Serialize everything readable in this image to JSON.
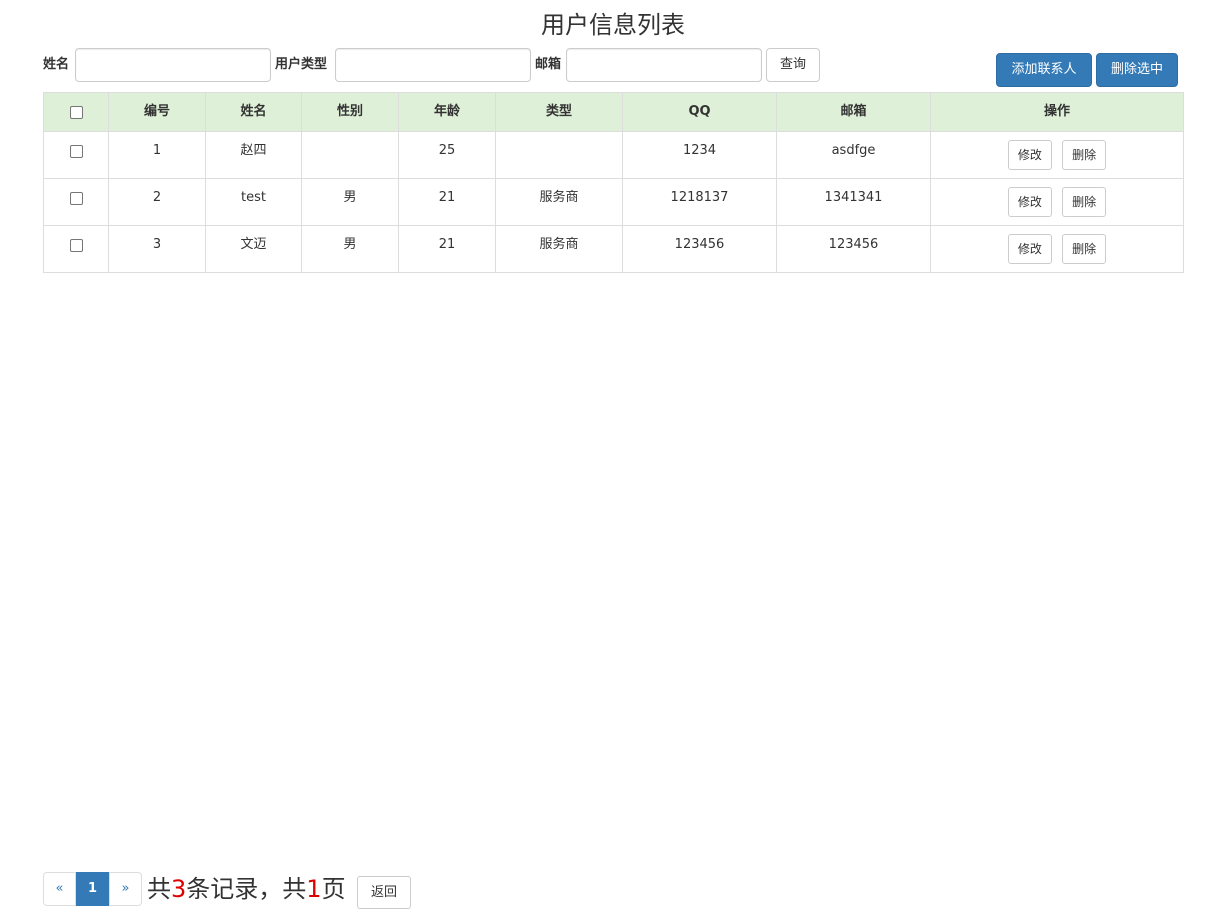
{
  "title": "用户信息列表",
  "search": {
    "name_label": "姓名",
    "name_value": "",
    "type_label": "用户类型",
    "type_value": "",
    "email_label": "邮箱",
    "email_value": "",
    "query_label": "查询"
  },
  "actions": {
    "add_label": "添加联系人",
    "delete_selected_label": "删除选中"
  },
  "table": {
    "headers": [
      "编号",
      "姓名",
      "性别",
      "年龄",
      "类型",
      "QQ",
      "邮箱",
      "操作"
    ],
    "rows": [
      {
        "id": "1",
        "name": "赵四",
        "gender": "",
        "age": "25",
        "type": "",
        "qq": "1234",
        "email": "asdfge"
      },
      {
        "id": "2",
        "name": "test",
        "gender": "男",
        "age": "21",
        "type": "服务商",
        "qq": "1218137",
        "email": "1341341"
      },
      {
        "id": "3",
        "name": "文迈",
        "gender": "男",
        "age": "21",
        "type": "服务商",
        "qq": "123456",
        "email": "123456"
      }
    ],
    "edit_label": "修改",
    "delete_label": "删除"
  },
  "pagination": {
    "prev": "«",
    "current_page": "1",
    "next": "»",
    "summary_prefix": "共",
    "total_records": "3",
    "summary_middle": "条记录，共",
    "total_pages": "1",
    "summary_suffix": "页",
    "back_label": "返回"
  },
  "colors": {
    "primary": "#337ab7",
    "header_bg": "#dff0d8",
    "highlight_number": "#dd0000"
  }
}
